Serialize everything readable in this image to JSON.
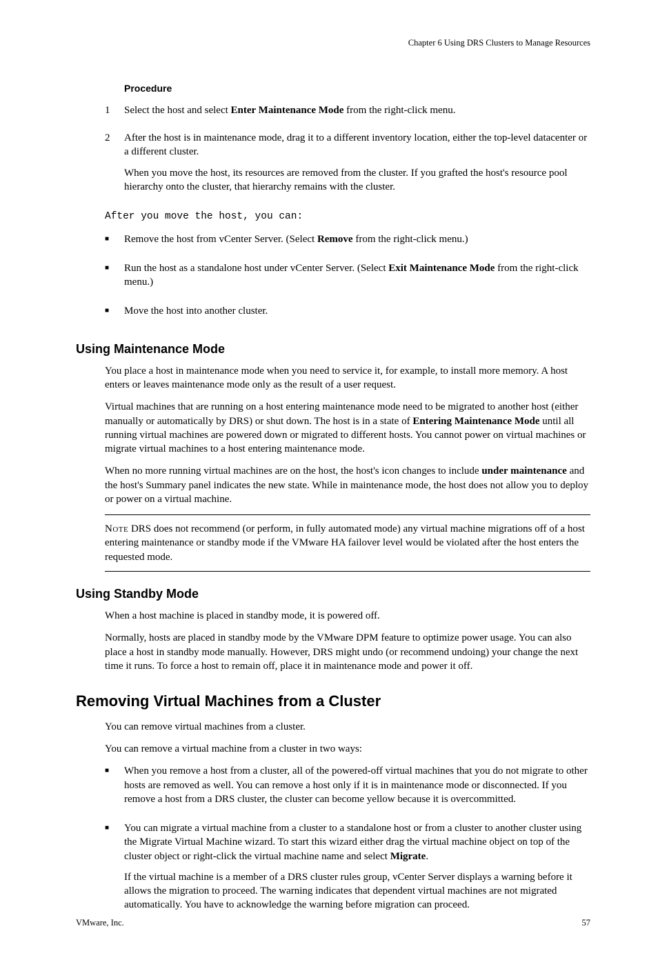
{
  "running_head": "Chapter 6 Using DRS Clusters to Manage Resources",
  "procedure_label": "Procedure",
  "steps": [
    {
      "num": "1",
      "paras": [
        {
          "runs": [
            {
              "t": "Select the host and select "
            },
            {
              "t": "Enter Maintenance Mode",
              "b": true
            },
            {
              "t": " from the right-click menu."
            }
          ]
        }
      ]
    },
    {
      "num": "2",
      "paras": [
        {
          "runs": [
            {
              "t": "After the host is in maintenance mode, drag it to a different inventory location, either the top-level datacenter or a different cluster."
            }
          ]
        },
        {
          "runs": [
            {
              "t": "When you move the host, its resources are removed from the cluster. If you grafted the host's resource pool hierarchy onto the cluster, that hierarchy remains with the cluster."
            }
          ]
        }
      ]
    }
  ],
  "mono_line": "After you move the host, you can:",
  "post_move_options": [
    {
      "paras": [
        {
          "runs": [
            {
              "t": "Remove the host from vCenter Server. (Select "
            },
            {
              "t": "Remove",
              "b": true
            },
            {
              "t": " from the right-click menu.)"
            }
          ]
        }
      ]
    },
    {
      "paras": [
        {
          "runs": [
            {
              "t": "Run the host as a standalone host under vCenter Server. (Select "
            },
            {
              "t": "Exit Maintenance Mode",
              "b": true
            },
            {
              "t": " from the right-click menu.)"
            }
          ]
        }
      ]
    },
    {
      "paras": [
        {
          "runs": [
            {
              "t": "Move the host into another cluster."
            }
          ]
        }
      ]
    }
  ],
  "sect_maint_title": "Using Maintenance Mode",
  "sect_maint_paras": [
    {
      "runs": [
        {
          "t": "You place a host in maintenance mode when you need to service it, for example, to install more memory. A host enters or leaves maintenance mode only as the result of a user request."
        }
      ]
    },
    {
      "runs": [
        {
          "t": "Virtual machines that are running on a host entering maintenance mode need to be migrated to another host (either manually or automatically by DRS) or shut down. The host is in a state of "
        },
        {
          "t": "Entering Maintenance Mode",
          "b": true
        },
        {
          "t": " until all running virtual machines are powered down or migrated to different hosts. You cannot power on virtual machines or migrate virtual machines to a host entering maintenance mode."
        }
      ]
    },
    {
      "runs": [
        {
          "t": "When no more running virtual machines are on the host, the host's icon changes to include "
        },
        {
          "t": "under maintenance",
          "b": true
        },
        {
          "t": " and the host's Summary panel indicates the new state. While in maintenance mode, the host does not allow you to deploy or power on a virtual machine."
        }
      ]
    }
  ],
  "note_label": "Note",
  "note_body": "   DRS does not recommend (or perform, in fully automated mode) any virtual machine migrations off of a host entering maintenance or standby mode if the VMware HA failover level would be violated after the host enters the requested mode.",
  "sect_standby_title": "Using Standby Mode",
  "sect_standby_paras": [
    {
      "runs": [
        {
          "t": "When a host machine is placed in standby mode, it is powered off."
        }
      ]
    },
    {
      "runs": [
        {
          "t": "Normally, hosts are placed in standby mode by the VMware DPM feature to optimize power usage. You can also place a host in standby mode manually. However, DRS might undo (or recommend undoing) your change the next time it runs. To force a host to remain off, place it in maintenance mode and power it off."
        }
      ]
    }
  ],
  "topic_remove_title": "Removing Virtual Machines from a Cluster",
  "topic_remove_intro": [
    {
      "runs": [
        {
          "t": "You can remove virtual machines from a cluster."
        }
      ]
    },
    {
      "runs": [
        {
          "t": "You can remove a virtual machine from a cluster in two ways:"
        }
      ]
    }
  ],
  "remove_bullets": [
    {
      "paras": [
        {
          "runs": [
            {
              "t": "When you remove a host from a cluster, all of the powered-off virtual machines that you do not migrate to other hosts are removed as well. You can remove a host only if it is in maintenance mode or disconnected. If you remove a host from a DRS cluster, the cluster can become yellow because it is overcommitted."
            }
          ]
        }
      ]
    },
    {
      "paras": [
        {
          "runs": [
            {
              "t": "You can migrate a virtual machine from a cluster to a standalone host or from a cluster to another cluster using the Migrate Virtual Machine wizard. To start this wizard either drag the virtual machine object on top of the cluster object or right-click the virtual machine name and select "
            },
            {
              "t": "Migrate",
              "b": true
            },
            {
              "t": "."
            }
          ]
        },
        {
          "runs": [
            {
              "t": "If the virtual machine is a member of a DRS cluster rules group, vCenter Server displays a warning before it allows the migration to proceed. The warning indicates that dependent virtual machines are not migrated automatically. You have to acknowledge the warning before migration can proceed."
            }
          ]
        }
      ]
    }
  ],
  "footer_left": "VMware, Inc.",
  "footer_right": "57"
}
